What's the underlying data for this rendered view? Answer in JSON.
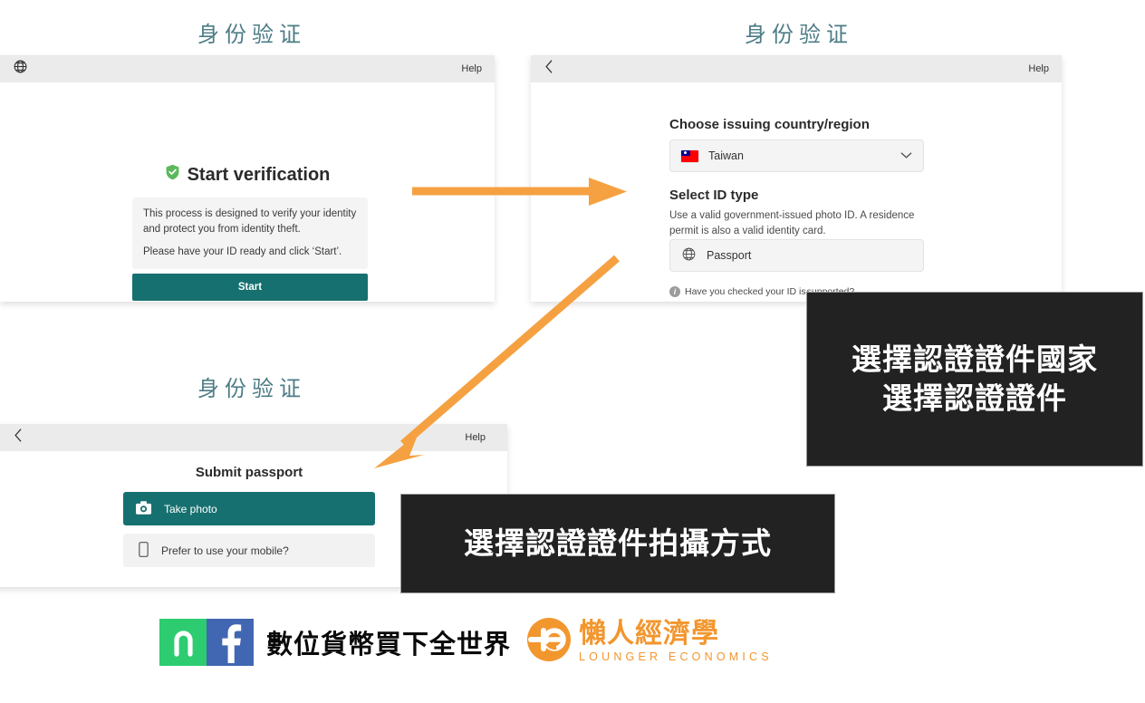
{
  "panels": [
    {
      "id": "start-verification",
      "title": "身份验证",
      "topbar": {
        "left_icon": "globe-icon",
        "help_label": "Help"
      },
      "heading": "Start verification",
      "heading_icon": "shield-check-icon",
      "body_paragraphs": [
        "This process is designed to verify your identity and protect you from identity theft.",
        "Please have your ID ready and click ‘Start’."
      ],
      "primary_button": "Start"
    },
    {
      "id": "choose-country",
      "title": "身份验证",
      "topbar": {
        "left_icon": "chevron-left-icon",
        "help_label": "Help"
      },
      "country_label": "Choose issuing country/region",
      "country_value": "Taiwan",
      "country_flag": "taiwan-flag-icon",
      "country_caret": "chevron-down-icon",
      "idtype_label": "Select ID type",
      "idtype_sub": "Use a valid government-issued photo ID. A residence permit is also a valid identity card.",
      "idtype_option": "Passport",
      "idtype_option_icon": "globe-icon",
      "hint_icon": "info-icon",
      "hint_text": "Have you checked your ID is ",
      "hint_link": "supported?"
    },
    {
      "id": "submit-passport",
      "title": "身份验证",
      "topbar": {
        "left_icon": "chevron-left-icon",
        "help_label": "Help"
      },
      "heading": "Submit passport",
      "options": [
        {
          "label": "Take photo",
          "icon": "camera-icon",
          "selected": true
        },
        {
          "label": "Prefer to use your mobile?",
          "icon": "mobile-icon",
          "selected": false
        }
      ]
    }
  ],
  "callouts": [
    {
      "id": "callout-country",
      "lines": [
        "選擇認證證件國家",
        "選擇認證證件"
      ]
    },
    {
      "id": "callout-capture",
      "lines": [
        "選擇認證證件拍攝方式"
      ]
    }
  ],
  "annotations": {
    "arrow_color": "#f5a142",
    "arrows": [
      {
        "id": "arrow-to-country-panel",
        "direction": "right"
      },
      {
        "id": "arrow-to-submit-panel",
        "direction": "down-left"
      }
    ]
  },
  "footer": {
    "social": [
      {
        "id": "line-icon",
        "color": "#2ecc71"
      },
      {
        "id": "facebook-icon",
        "color": "#4267b2",
        "glyph": "f"
      }
    ],
    "tagline": "數位貨幣買下全世界",
    "brand_mark": "le-monogram-icon",
    "brand_cn": "懶人經濟學",
    "brand_en": "LOUNGER ECONOMICS",
    "brand_color": "#f2962e"
  },
  "colors": {
    "title": "#4d7c86",
    "teal": "#177070",
    "orange": "#f5a142",
    "topbar_bg": "#ebebeb",
    "callout_bg": "#222222"
  }
}
